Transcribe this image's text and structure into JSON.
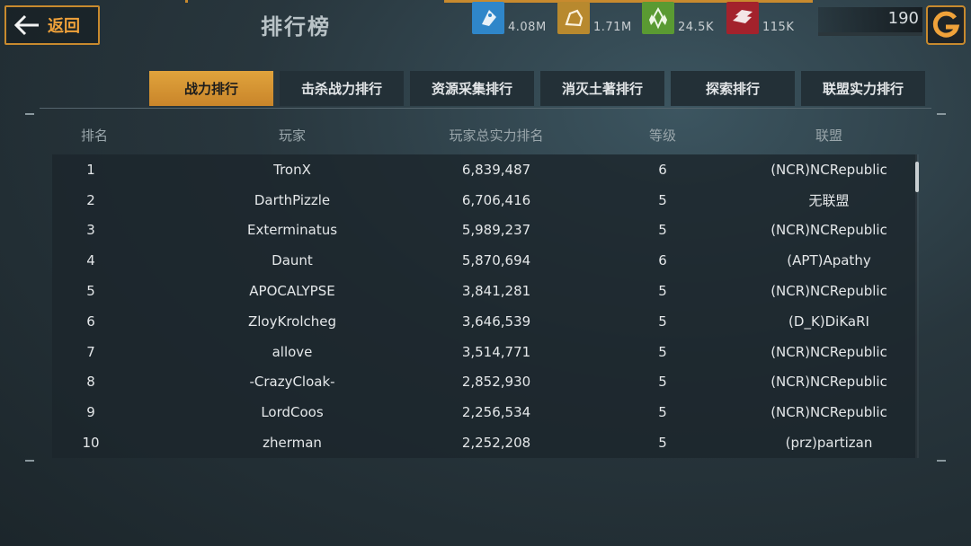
{
  "header": {
    "back_label": "返回",
    "title": "排行榜",
    "resources": [
      {
        "name": "food",
        "icon": "tag-icon",
        "value": "4.08M",
        "color": "#2f86c9"
      },
      {
        "name": "ore",
        "icon": "rock-icon",
        "value": "1.71M",
        "color": "#b8892e"
      },
      {
        "name": "crystal",
        "icon": "crystal-icon",
        "value": "24.5K",
        "color": "#5a9a32"
      },
      {
        "name": "steel",
        "icon": "ingot-icon",
        "value": "115K",
        "color": "#a3222c"
      }
    ],
    "power_value": "190"
  },
  "tabs": [
    {
      "label": "战力排行",
      "active": true
    },
    {
      "label": "击杀战力排行",
      "active": false
    },
    {
      "label": "资源采集排行",
      "active": false
    },
    {
      "label": "消灭土著排行",
      "active": false
    },
    {
      "label": "探索排行",
      "active": false
    },
    {
      "label": "联盟实力排行",
      "active": false
    }
  ],
  "table": {
    "columns": [
      "排名",
      "玩家",
      "玩家总实力排名",
      "等级",
      "联盟"
    ],
    "rows": [
      {
        "rank": "1",
        "player": "TronX",
        "power": "6,839,487",
        "level": "6",
        "alliance": "(NCR)NCRepublic"
      },
      {
        "rank": "2",
        "player": "DarthPizzle",
        "power": "6,706,416",
        "level": "5",
        "alliance": "无联盟"
      },
      {
        "rank": "3",
        "player": "Exterminatus",
        "power": "5,989,237",
        "level": "5",
        "alliance": "(NCR)NCRepublic"
      },
      {
        "rank": "4",
        "player": "Daunt",
        "power": "5,870,694",
        "level": "6",
        "alliance": "(APT)Apathy"
      },
      {
        "rank": "5",
        "player": "APOCALYPSE",
        "power": "3,841,281",
        "level": "5",
        "alliance": "(NCR)NCRepublic"
      },
      {
        "rank": "6",
        "player": "ZloyKrolcheg",
        "power": "3,646,539",
        "level": "5",
        "alliance": "(D_K)DiKaRI"
      },
      {
        "rank": "7",
        "player": "allove",
        "power": "3,514,771",
        "level": "5",
        "alliance": "(NCR)NCRepublic"
      },
      {
        "rank": "8",
        "player": "-CrazyCloak-",
        "power": "2,852,930",
        "level": "5",
        "alliance": "(NCR)NCRepublic"
      },
      {
        "rank": "9",
        "player": "LordCoos",
        "power": "2,256,534",
        "level": "5",
        "alliance": "(NCR)NCRepublic"
      },
      {
        "rank": "10",
        "player": "zherman",
        "power": "2,252,208",
        "level": "5",
        "alliance": "(prz)partizan"
      }
    ]
  }
}
